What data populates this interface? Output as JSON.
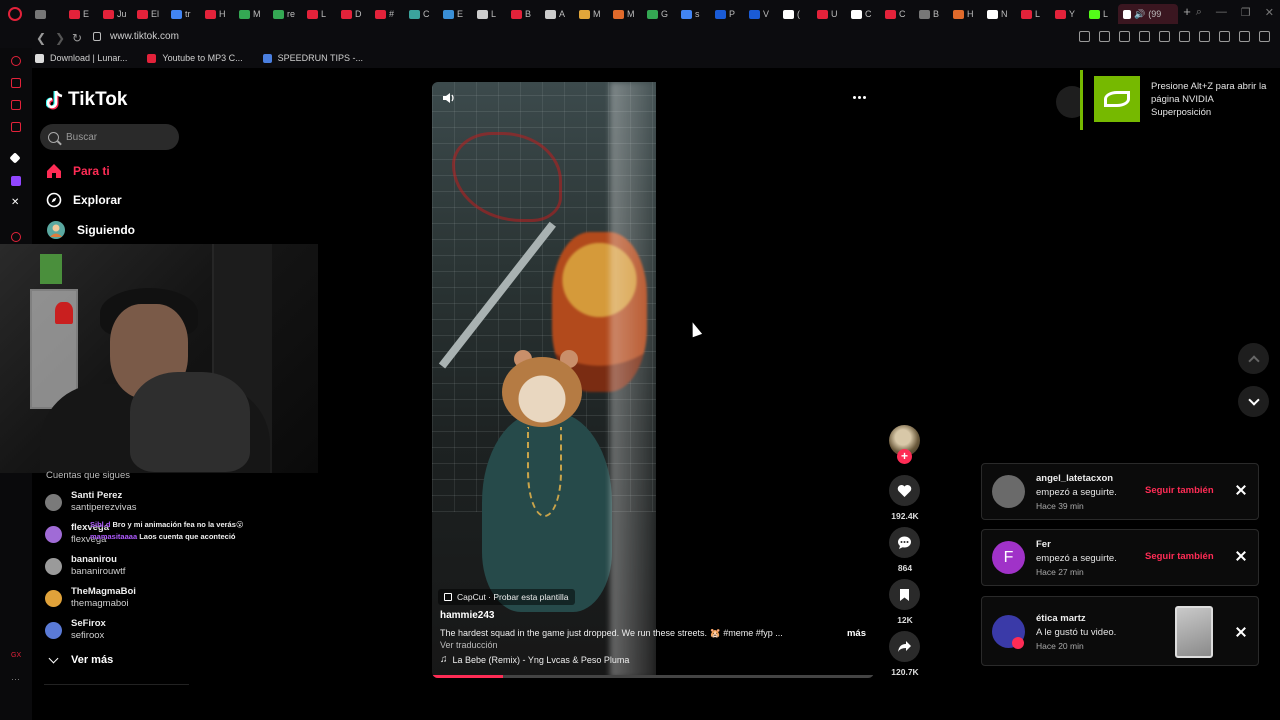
{
  "browser": {
    "url": "www.tiktok.com",
    "active_tab_label": "(99",
    "tabs": [
      {
        "label": "",
        "color": "#777777"
      },
      {
        "label": "E",
        "color": "#e3223a"
      },
      {
        "label": "Ju",
        "color": "#e3223a"
      },
      {
        "label": "El",
        "color": "#e3223a"
      },
      {
        "label": "tr",
        "color": "#4285f4"
      },
      {
        "label": "H",
        "color": "#e3223a"
      },
      {
        "label": "M",
        "color": "#34a853"
      },
      {
        "label": "re",
        "color": "#34a853"
      },
      {
        "label": "L",
        "color": "#e3223a"
      },
      {
        "label": "D",
        "color": "#e3223a"
      },
      {
        "label": "#",
        "color": "#e3223a"
      },
      {
        "label": "C",
        "color": "#3ba39c"
      },
      {
        "label": "E",
        "color": "#3a8fd6"
      },
      {
        "label": "L",
        "color": "#cccccc"
      },
      {
        "label": "B",
        "color": "#e3223a"
      },
      {
        "label": "A",
        "color": "#cccccc"
      },
      {
        "label": "M",
        "color": "#e2a63a"
      },
      {
        "label": "M",
        "color": "#e06a2b"
      },
      {
        "label": "G",
        "color": "#34a853"
      },
      {
        "label": "s",
        "color": "#4285f4"
      },
      {
        "label": "P",
        "color": "#1a5bd6"
      },
      {
        "label": "V",
        "color": "#1a5bd6"
      },
      {
        "label": "(",
        "color": "#ffffff"
      },
      {
        "label": "U",
        "color": "#e3223a"
      },
      {
        "label": "C",
        "color": "#ffffff"
      },
      {
        "label": "C",
        "color": "#e3223a"
      },
      {
        "label": "B",
        "color": "#777777"
      },
      {
        "label": "H",
        "color": "#e06a2b"
      },
      {
        "label": "N",
        "color": "#ffffff"
      },
      {
        "label": "L",
        "color": "#e3223a"
      },
      {
        "label": "Y",
        "color": "#e3223a"
      },
      {
        "label": "L",
        "color": "#53fc18"
      }
    ],
    "bookmarks": [
      {
        "label": "Download | Lunar...",
        "color": "#dddddd"
      },
      {
        "label": "Youtube to MP3 C...",
        "color": "#e3223a"
      },
      {
        "label": "SPEEDRUN TIPS -...",
        "color": "#4a7fe0"
      }
    ]
  },
  "tiktok": {
    "logo": "TikTok",
    "search_placeholder": "Buscar",
    "nav": {
      "for_you": "Para ti",
      "explore": "Explorar",
      "following": "Siguiendo"
    },
    "following_section_title": "Cuentas que sigues",
    "followed_accounts": [
      {
        "name": "Santi Perez",
        "handle": "santiperezvivas",
        "color": "#7a7a7a"
      },
      {
        "name": "flexvega",
        "handle": "flexvega",
        "color": "#a06bd6"
      },
      {
        "name": "bananirou",
        "handle": "bananirouwtf",
        "color": "#9a9a9a"
      },
      {
        "name": "TheMagmaBoi",
        "handle": "themagmaboi",
        "color": "#e0a23a"
      },
      {
        "name": "SeFirox",
        "handle": "sefiroox",
        "color": "#5a7ad6"
      }
    ],
    "see_more": "Ver más",
    "chat_overlay": {
      "line1_user": "Sibl.d",
      "line1": "Bro y mi animación fea no la verás😮",
      "line2_user": "mamasitaaaa",
      "line2": "Laos cuenta que aconteció"
    },
    "video": {
      "capcut": "CapCut · Probar esta plantilla",
      "author": "hammie243",
      "caption": "The hardest squad in the game just dropped. We run these streets. 🐹 #meme #fyp ...",
      "more": "más",
      "translate": "Ver traducción",
      "music": "La Bebe (Remix) - Yng Lvcas & Peso Pluma",
      "progress_fraction": 0.16
    },
    "actions": {
      "likes": "192.4K",
      "comments": "864",
      "saves": "12K",
      "shares": "120.7K"
    },
    "notifications": [
      {
        "name": "angel_latetacxon",
        "message": "empezó a seguirte.",
        "time": "Hace 39 min",
        "action": "Seguir también",
        "avatar": "",
        "avatar_color": "#6a6a6a"
      },
      {
        "name": "Fer",
        "message": "empezó a seguirte.",
        "time": "Hace 27 min",
        "action": "Seguir también",
        "avatar": "F",
        "avatar_color": "#a032c8"
      },
      {
        "name": "ética martz",
        "message": "A le gustó tu video.",
        "time": "Hace 20 min",
        "action": "",
        "avatar": "",
        "avatar_color": "#3a3aa8"
      }
    ]
  },
  "nvidia": {
    "message": "Presione Alt+Z para abrir la página NVIDIA Superposición"
  },
  "colors": {
    "accent": "#fe2c55",
    "nvidia": "#76b900",
    "background": "#000000"
  }
}
